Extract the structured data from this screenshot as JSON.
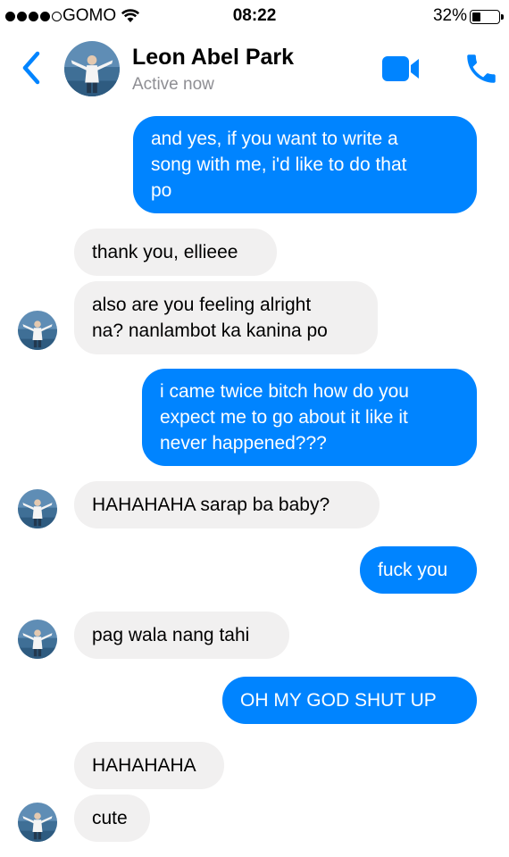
{
  "status_bar": {
    "carrier": "GOMO",
    "time": "08:22",
    "battery": "32%",
    "battery_level": 0.32,
    "signal_bars": 4,
    "signal_max": 5
  },
  "header": {
    "name": "Leon Abel Park",
    "status": "Active now",
    "icons": [
      "back-chevron-icon",
      "avatar",
      "video-camera-icon",
      "phone-icon"
    ]
  },
  "colors": {
    "accent": "#0084ff",
    "incoming_bubble": "#f1f0f0",
    "status_gray": "#8e8e93"
  },
  "messages": [
    {
      "from": "me",
      "text": "and yes, if you want to write a\nsong with me, i'd like to do that\npo"
    },
    {
      "from": "contact",
      "text": "thank you, ellieee"
    },
    {
      "from": "contact",
      "text": "also are you feeling alright\nna? nanlambot ka kanina po"
    },
    {
      "from": "me",
      "text": "i came twice bitch how do you\nexpect me to go about it like it\nnever happened???"
    },
    {
      "from": "contact",
      "text": "HAHAHAHA sarap ba baby?"
    },
    {
      "from": "me",
      "text": "fuck you"
    },
    {
      "from": "contact",
      "text": "pag wala nang tahi"
    },
    {
      "from": "me",
      "text": "OH MY GOD SHUT UP"
    },
    {
      "from": "contact",
      "text": "HAHAHAHA"
    },
    {
      "from": "contact",
      "text": "cute"
    }
  ]
}
